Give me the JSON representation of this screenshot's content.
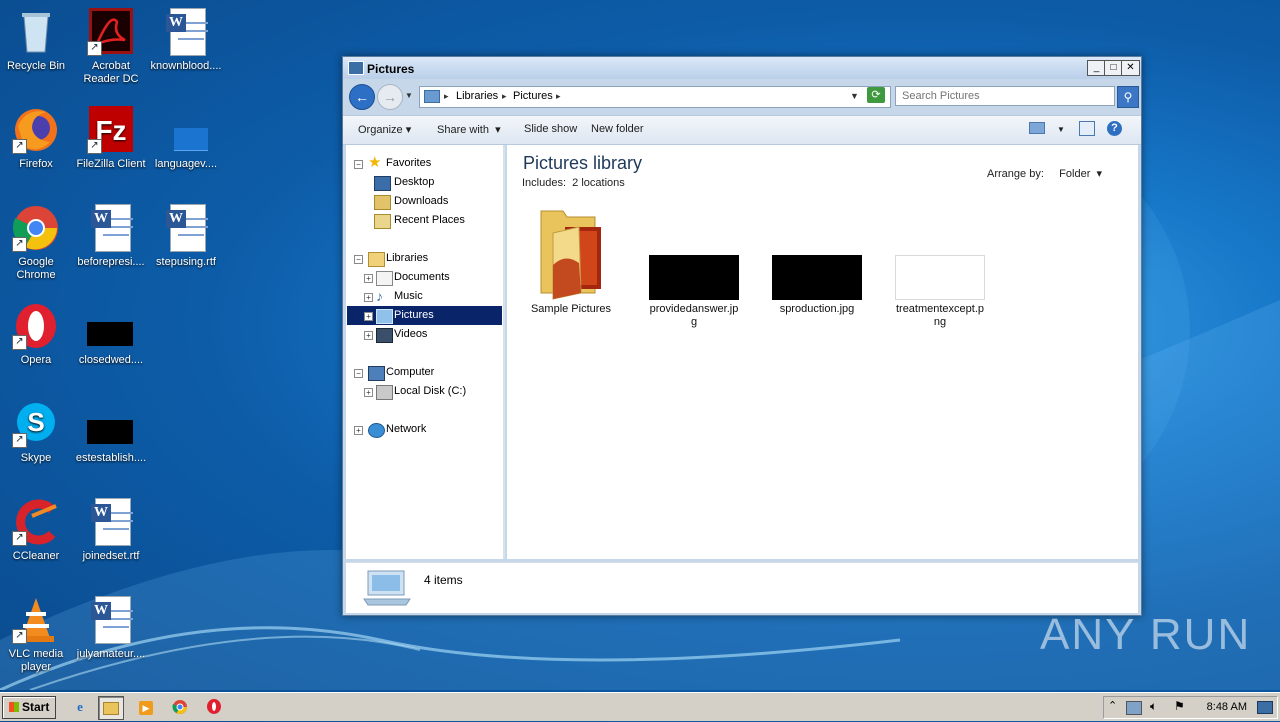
{
  "desktop": {
    "icons": [
      {
        "label": "Recycle Bin",
        "icon": "recycle-bin-icon"
      },
      {
        "label": "Acrobat Reader DC",
        "icon": "acrobat-icon"
      },
      {
        "label": "knownblood....",
        "icon": "word-doc-icon"
      },
      {
        "label": "Firefox",
        "icon": "firefox-icon"
      },
      {
        "label": "FileZilla Client",
        "icon": "filezilla-icon"
      },
      {
        "label": "languagev....",
        "icon": "file-icon"
      },
      {
        "label": "Google Chrome",
        "icon": "chrome-icon"
      },
      {
        "label": "beforepresi....",
        "icon": "word-doc-icon"
      },
      {
        "label": "stepusing.rtf",
        "icon": "word-doc-icon"
      },
      {
        "label": "Opera",
        "icon": "opera-icon"
      },
      {
        "label": "closedwed....",
        "icon": "image-thumb-icon"
      },
      {
        "label": "Skype",
        "icon": "skype-icon"
      },
      {
        "label": "estestablish....",
        "icon": "image-thumb-icon"
      },
      {
        "label": "CCleaner",
        "icon": "ccleaner-icon"
      },
      {
        "label": "joinedset.rtf",
        "icon": "word-doc-icon"
      },
      {
        "label": "VLC media player",
        "icon": "vlc-icon"
      },
      {
        "label": "julyamateur....",
        "icon": "word-doc-icon"
      }
    ]
  },
  "window": {
    "title": "Pictures",
    "address": {
      "crumbs": [
        "Libraries",
        "Pictures"
      ]
    },
    "search": {
      "placeholder": "Search Pictures"
    },
    "toolbar": {
      "organize": "Organize",
      "share_with": "Share with",
      "slide_show": "Slide show",
      "new_folder": "New folder"
    },
    "nav": {
      "favorites": "Favorites",
      "desktop": "Desktop",
      "downloads": "Downloads",
      "recent": "Recent Places",
      "libraries": "Libraries",
      "documents": "Documents",
      "music": "Music",
      "pictures": "Pictures",
      "videos": "Videos",
      "computer": "Computer",
      "local_disk": "Local Disk (C:)",
      "network": "Network"
    },
    "main": {
      "title": "Pictures library",
      "includes_label": "Includes:",
      "includes_value": "2 locations",
      "arrange_label": "Arrange by:",
      "arrange_value": "Folder",
      "files": [
        {
          "name": "Sample Pictures",
          "kind": "folder"
        },
        {
          "name": "providedanswer.jpg",
          "kind": "image-black"
        },
        {
          "name": "sproduction.jpg",
          "kind": "image-black"
        },
        {
          "name": "treatmentexcept.png",
          "kind": "image-white"
        }
      ]
    },
    "status": {
      "count": "4 items"
    }
  },
  "taskbar": {
    "start": "Start",
    "clock": "8:48 AM"
  },
  "watermark": "ANY RUN"
}
